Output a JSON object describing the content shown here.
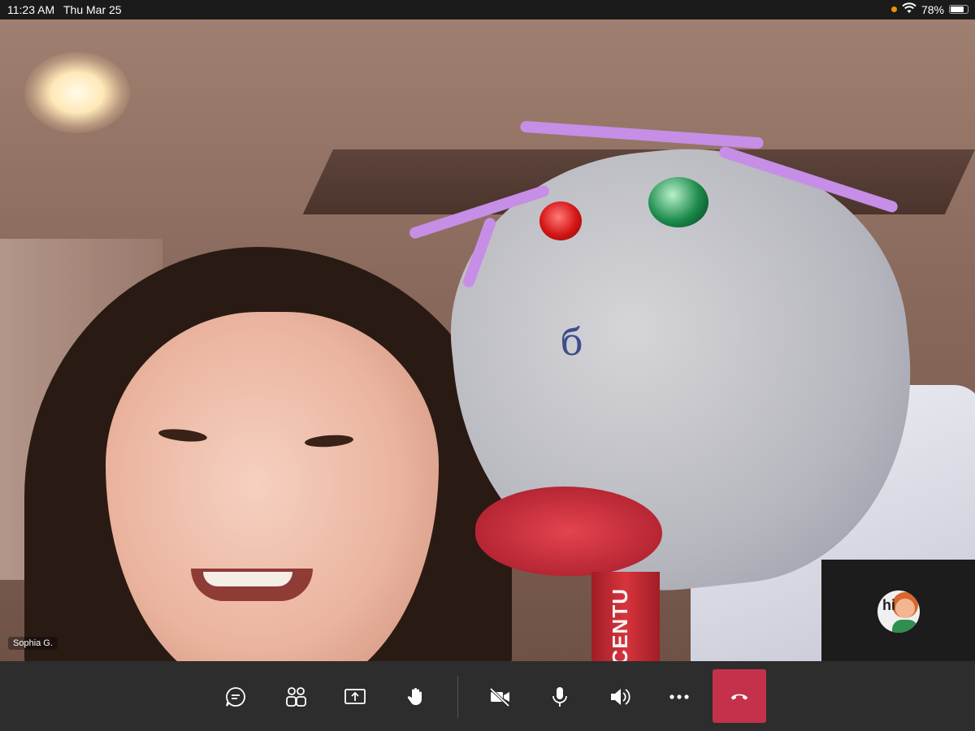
{
  "status_bar": {
    "time": "11:23 AM",
    "date": "Thu Mar 25",
    "battery_percent": "78%",
    "battery_level": 0.78,
    "icons": [
      "orange-dot-icon",
      "wifi-icon",
      "battery-icon"
    ]
  },
  "call": {
    "participant_name": "Sophia G.",
    "marker_text": "CENTU",
    "self_view_avatar_text": "hi"
  },
  "toolbar": {
    "buttons": [
      {
        "name": "chat",
        "icon": "chat-icon"
      },
      {
        "name": "participants",
        "icon": "participants-icon"
      },
      {
        "name": "share-screen",
        "icon": "share-screen-icon"
      },
      {
        "name": "raise-hand",
        "icon": "hand-icon"
      },
      {
        "name": "camera",
        "icon": "camera-off-icon"
      },
      {
        "name": "microphone",
        "icon": "microphone-icon"
      },
      {
        "name": "speaker",
        "icon": "speaker-icon"
      },
      {
        "name": "more",
        "icon": "more-icon"
      },
      {
        "name": "leave",
        "icon": "hang-up-icon"
      }
    ]
  },
  "colors": {
    "toolbar_bg": "#2d2d2d",
    "hangup_red": "#c4314b",
    "status_bar_bg": "#1b1b1b"
  }
}
